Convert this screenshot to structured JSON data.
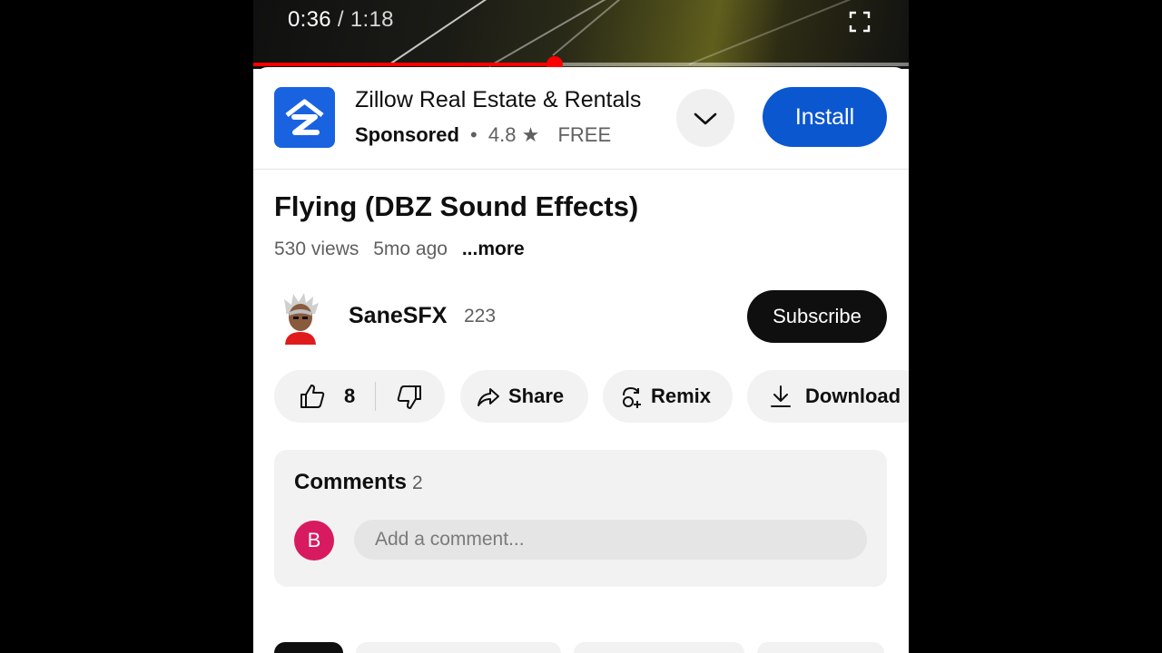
{
  "player": {
    "current_time": "0:36",
    "separator": "/",
    "duration": "1:18",
    "progress_fraction": 0.46,
    "progress_color": "#ff0000"
  },
  "ad": {
    "app_name": "Zillow Real Estate & Rentals",
    "sponsored_label": "Sponsored",
    "dot": "•",
    "rating": "4.8",
    "star_icon": "star-icon",
    "price": "FREE",
    "install_label": "Install",
    "accent_color": "#0b57d0"
  },
  "video": {
    "title": "Flying (DBZ Sound Effects)",
    "views": "530 views",
    "age": "5mo ago",
    "more_label": "...more"
  },
  "channel": {
    "name": "SaneSFX",
    "subscribers": "223",
    "subscribe_label": "Subscribe"
  },
  "actions": {
    "like_count": "8",
    "share_label": "Share",
    "remix_label": "Remix",
    "download_label": "Download"
  },
  "comments": {
    "heading": "Comments",
    "count": "2",
    "user_initial": "B",
    "user_color": "#d81b60",
    "placeholder": "Add a comment..."
  }
}
